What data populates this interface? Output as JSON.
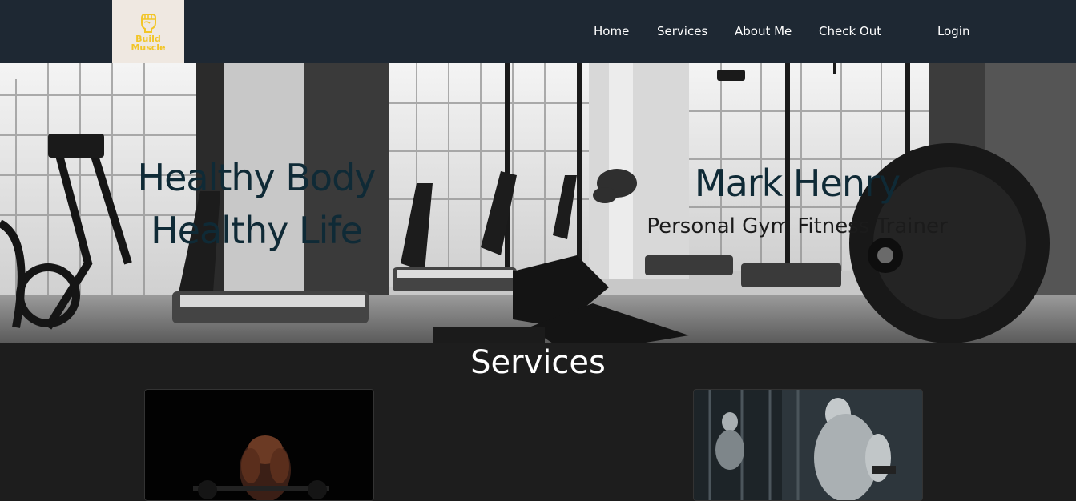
{
  "logo": {
    "icon": "fist-icon",
    "line1": "Build",
    "line2": "Muscle",
    "color": "#f2c527"
  },
  "nav": {
    "items": [
      {
        "label": "Home"
      },
      {
        "label": "Services"
      },
      {
        "label": "About Me"
      },
      {
        "label": "Check Out"
      },
      {
        "label": "Login"
      }
    ]
  },
  "hero": {
    "title_line1": "Healthy Body",
    "title_line2": "Healthy Life",
    "name": "Mark Henry",
    "subtitle": "Personal Gym Fitness Trainer"
  },
  "services": {
    "heading": "Services"
  },
  "colors": {
    "navbar": "#1e2833",
    "page_bg": "#1d1d1d",
    "hero_text": "#0f2a36"
  }
}
